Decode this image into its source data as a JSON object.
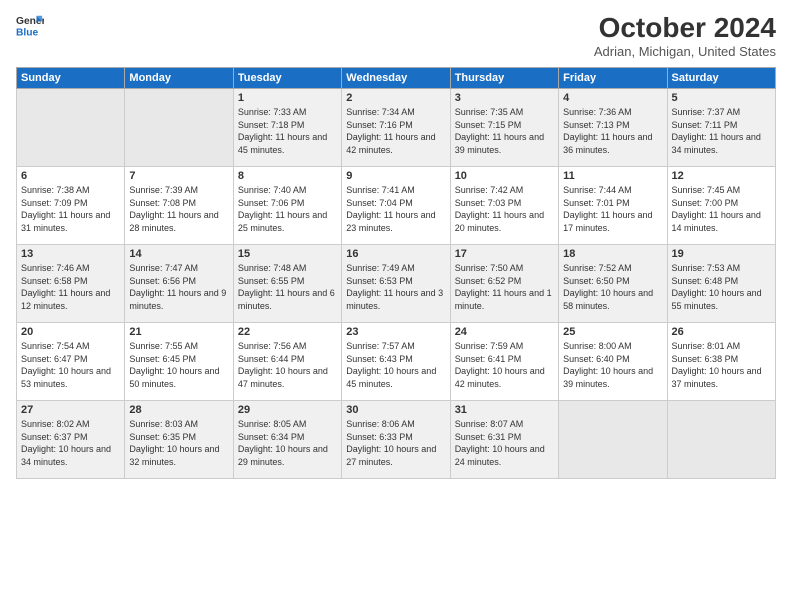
{
  "logo": {
    "line1": "General",
    "line2": "Blue"
  },
  "title": "October 2024",
  "location": "Adrian, Michigan, United States",
  "days_of_week": [
    "Sunday",
    "Monday",
    "Tuesday",
    "Wednesday",
    "Thursday",
    "Friday",
    "Saturday"
  ],
  "weeks": [
    [
      {
        "day": "",
        "empty": true
      },
      {
        "day": "",
        "empty": true
      },
      {
        "day": "1",
        "sunrise": "7:33 AM",
        "sunset": "7:18 PM",
        "daylight": "11 hours and 45 minutes."
      },
      {
        "day": "2",
        "sunrise": "7:34 AM",
        "sunset": "7:16 PM",
        "daylight": "11 hours and 42 minutes."
      },
      {
        "day": "3",
        "sunrise": "7:35 AM",
        "sunset": "7:15 PM",
        "daylight": "11 hours and 39 minutes."
      },
      {
        "day": "4",
        "sunrise": "7:36 AM",
        "sunset": "7:13 PM",
        "daylight": "11 hours and 36 minutes."
      },
      {
        "day": "5",
        "sunrise": "7:37 AM",
        "sunset": "7:11 PM",
        "daylight": "11 hours and 34 minutes."
      }
    ],
    [
      {
        "day": "6",
        "sunrise": "7:38 AM",
        "sunset": "7:09 PM",
        "daylight": "11 hours and 31 minutes."
      },
      {
        "day": "7",
        "sunrise": "7:39 AM",
        "sunset": "7:08 PM",
        "daylight": "11 hours and 28 minutes."
      },
      {
        "day": "8",
        "sunrise": "7:40 AM",
        "sunset": "7:06 PM",
        "daylight": "11 hours and 25 minutes."
      },
      {
        "day": "9",
        "sunrise": "7:41 AM",
        "sunset": "7:04 PM",
        "daylight": "11 hours and 23 minutes."
      },
      {
        "day": "10",
        "sunrise": "7:42 AM",
        "sunset": "7:03 PM",
        "daylight": "11 hours and 20 minutes."
      },
      {
        "day": "11",
        "sunrise": "7:44 AM",
        "sunset": "7:01 PM",
        "daylight": "11 hours and 17 minutes."
      },
      {
        "day": "12",
        "sunrise": "7:45 AM",
        "sunset": "7:00 PM",
        "daylight": "11 hours and 14 minutes."
      }
    ],
    [
      {
        "day": "13",
        "sunrise": "7:46 AM",
        "sunset": "6:58 PM",
        "daylight": "11 hours and 12 minutes."
      },
      {
        "day": "14",
        "sunrise": "7:47 AM",
        "sunset": "6:56 PM",
        "daylight": "11 hours and 9 minutes."
      },
      {
        "day": "15",
        "sunrise": "7:48 AM",
        "sunset": "6:55 PM",
        "daylight": "11 hours and 6 minutes."
      },
      {
        "day": "16",
        "sunrise": "7:49 AM",
        "sunset": "6:53 PM",
        "daylight": "11 hours and 3 minutes."
      },
      {
        "day": "17",
        "sunrise": "7:50 AM",
        "sunset": "6:52 PM",
        "daylight": "11 hours and 1 minute."
      },
      {
        "day": "18",
        "sunrise": "7:52 AM",
        "sunset": "6:50 PM",
        "daylight": "10 hours and 58 minutes."
      },
      {
        "day": "19",
        "sunrise": "7:53 AM",
        "sunset": "6:48 PM",
        "daylight": "10 hours and 55 minutes."
      }
    ],
    [
      {
        "day": "20",
        "sunrise": "7:54 AM",
        "sunset": "6:47 PM",
        "daylight": "10 hours and 53 minutes."
      },
      {
        "day": "21",
        "sunrise": "7:55 AM",
        "sunset": "6:45 PM",
        "daylight": "10 hours and 50 minutes."
      },
      {
        "day": "22",
        "sunrise": "7:56 AM",
        "sunset": "6:44 PM",
        "daylight": "10 hours and 47 minutes."
      },
      {
        "day": "23",
        "sunrise": "7:57 AM",
        "sunset": "6:43 PM",
        "daylight": "10 hours and 45 minutes."
      },
      {
        "day": "24",
        "sunrise": "7:59 AM",
        "sunset": "6:41 PM",
        "daylight": "10 hours and 42 minutes."
      },
      {
        "day": "25",
        "sunrise": "8:00 AM",
        "sunset": "6:40 PM",
        "daylight": "10 hours and 39 minutes."
      },
      {
        "day": "26",
        "sunrise": "8:01 AM",
        "sunset": "6:38 PM",
        "daylight": "10 hours and 37 minutes."
      }
    ],
    [
      {
        "day": "27",
        "sunrise": "8:02 AM",
        "sunset": "6:37 PM",
        "daylight": "10 hours and 34 minutes."
      },
      {
        "day": "28",
        "sunrise": "8:03 AM",
        "sunset": "6:35 PM",
        "daylight": "10 hours and 32 minutes."
      },
      {
        "day": "29",
        "sunrise": "8:05 AM",
        "sunset": "6:34 PM",
        "daylight": "10 hours and 29 minutes."
      },
      {
        "day": "30",
        "sunrise": "8:06 AM",
        "sunset": "6:33 PM",
        "daylight": "10 hours and 27 minutes."
      },
      {
        "day": "31",
        "sunrise": "8:07 AM",
        "sunset": "6:31 PM",
        "daylight": "10 hours and 24 minutes."
      },
      {
        "day": "",
        "empty": true
      },
      {
        "day": "",
        "empty": true
      }
    ]
  ],
  "labels": {
    "sunrise": "Sunrise:",
    "sunset": "Sunset:",
    "daylight": "Daylight:"
  }
}
